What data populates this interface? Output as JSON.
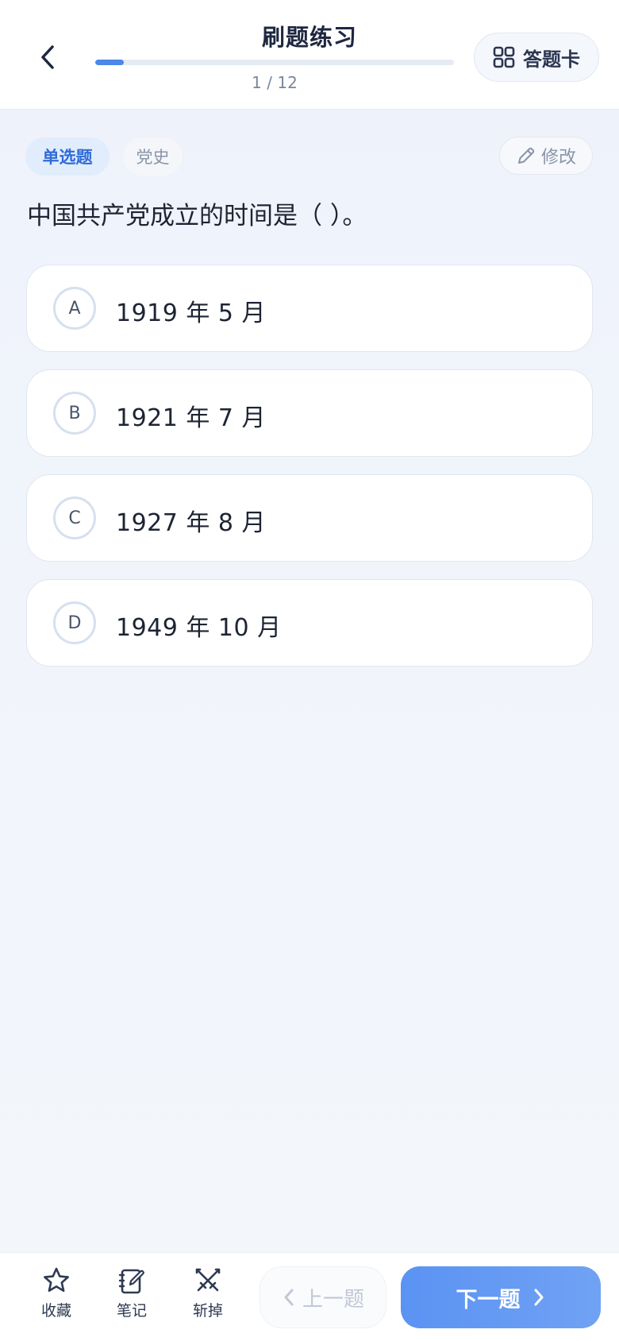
{
  "header": {
    "title": "刷题练习",
    "progress_text": "1 / 12",
    "progress_fraction": 0.08,
    "answer_card_label": "答题卡"
  },
  "tags": {
    "type": "单选题",
    "category": "党史"
  },
  "edit_label": "修改",
  "question": "中国共产党成立的时间是（ ）。",
  "options": [
    {
      "letter": "A",
      "text": "1919 年 5 月"
    },
    {
      "letter": "B",
      "text": "1921 年 7 月"
    },
    {
      "letter": "C",
      "text": "1927 年 8 月"
    },
    {
      "letter": "D",
      "text": "1949 年 10 月"
    }
  ],
  "bottom": {
    "favorite_label": "收藏",
    "notes_label": "笔记",
    "remove_label": "斩掉",
    "prev_label": "上一题",
    "next_label": "下一题"
  },
  "colors": {
    "accent": "#4c87ea",
    "primary_button": "#5b93f3",
    "text_dark": "#1d2433"
  }
}
